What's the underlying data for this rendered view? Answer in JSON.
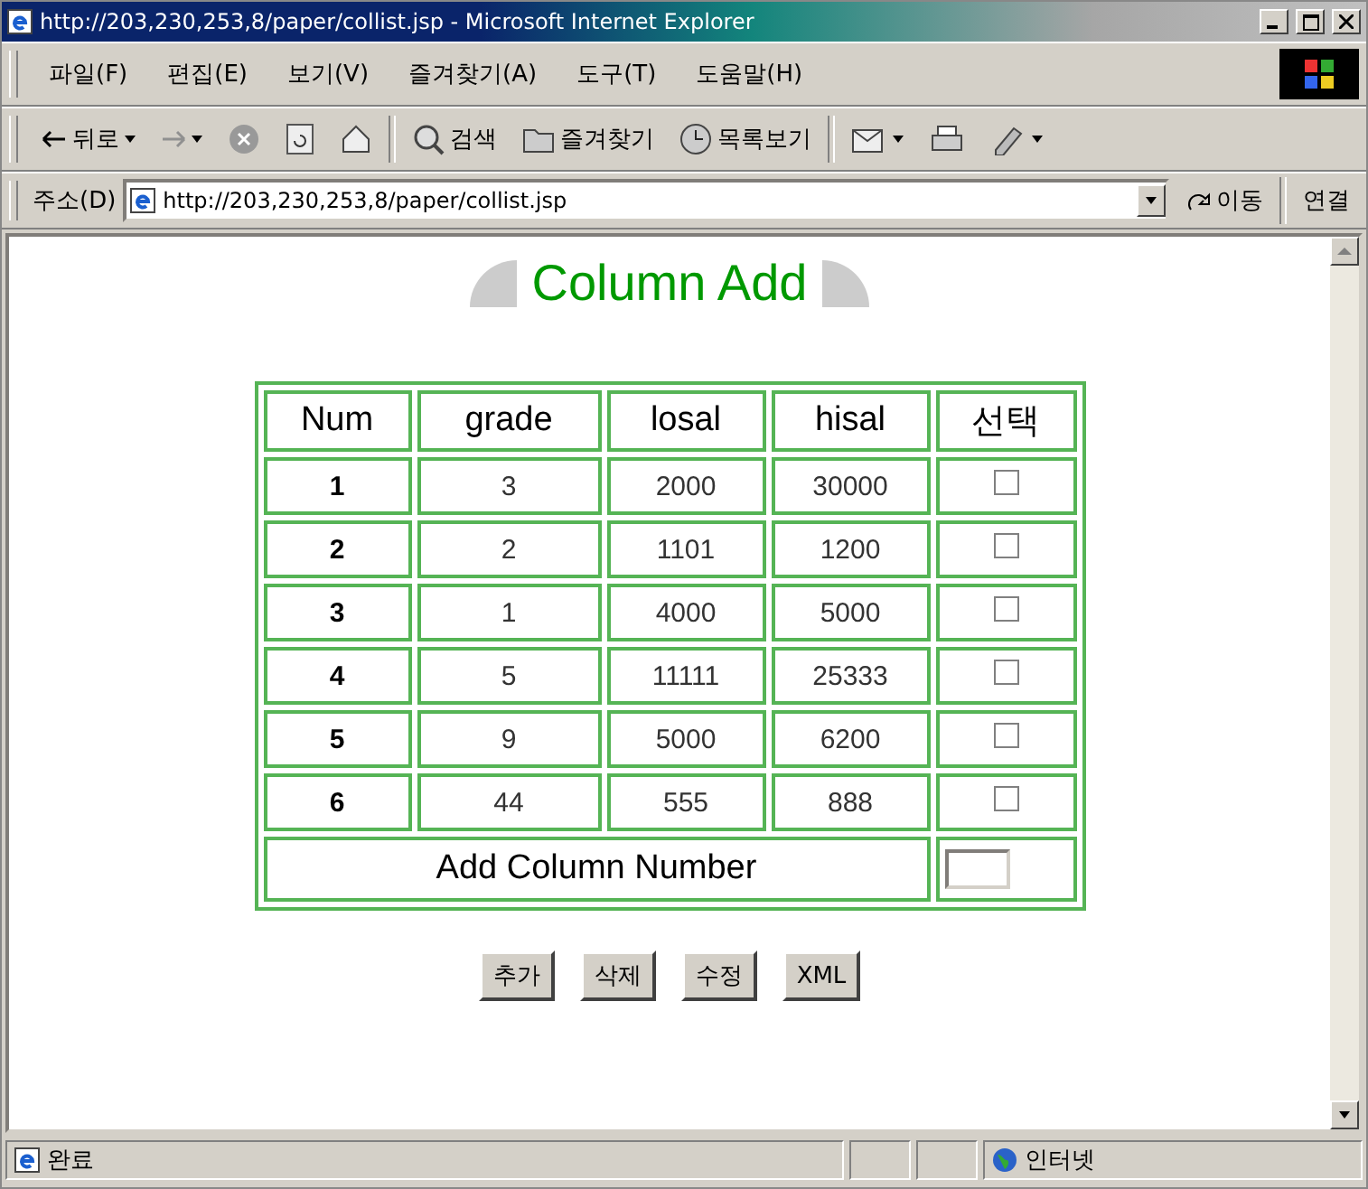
{
  "window": {
    "title": "http://203,230,253,8/paper/collist.jsp - Microsoft Internet Explorer"
  },
  "menu": [
    "파일(F)",
    "편집(E)",
    "보기(V)",
    "즐겨찾기(A)",
    "도구(T)",
    "도움말(H)"
  ],
  "toolbar": [
    {
      "kind": "back",
      "label": "뒤로"
    },
    {
      "kind": "forward"
    },
    {
      "kind": "stop"
    },
    {
      "kind": "refresh"
    },
    {
      "kind": "home"
    },
    {
      "kind": "search",
      "label": "검색"
    },
    {
      "kind": "favorites",
      "label": "즐겨찾기"
    },
    {
      "kind": "history",
      "label": "목록보기"
    },
    {
      "kind": "mail"
    },
    {
      "kind": "print"
    },
    {
      "kind": "edit"
    }
  ],
  "address": {
    "label": "주소(D)",
    "url": "http://203,230,253,8/paper/collist.jsp",
    "go": "이동",
    "links": "연결"
  },
  "page": {
    "heading": "Column Add",
    "table": {
      "columns": [
        "Num",
        "grade",
        "losal",
        "hisal",
        "선택"
      ],
      "rows": [
        {
          "cells": [
            "1",
            "3",
            "2000",
            "30000"
          ],
          "checked": false
        },
        {
          "cells": [
            "2",
            "2",
            "1101",
            "1200"
          ],
          "checked": false
        },
        {
          "cells": [
            "3",
            "1",
            "4000",
            "5000"
          ],
          "checked": false
        },
        {
          "cells": [
            "4",
            "5",
            "11111",
            "25333"
          ],
          "checked": false
        },
        {
          "cells": [
            "5",
            "9",
            "5000",
            "6200"
          ],
          "checked": false
        },
        {
          "cells": [
            "6",
            "44",
            "555",
            "888"
          ],
          "checked": false
        }
      ],
      "footer_label": "Add Column Number"
    },
    "buttons": [
      "추가",
      "삭제",
      "수정",
      "XML"
    ]
  },
  "status_bar": {
    "text": "완료",
    "zone": "인터넷"
  }
}
